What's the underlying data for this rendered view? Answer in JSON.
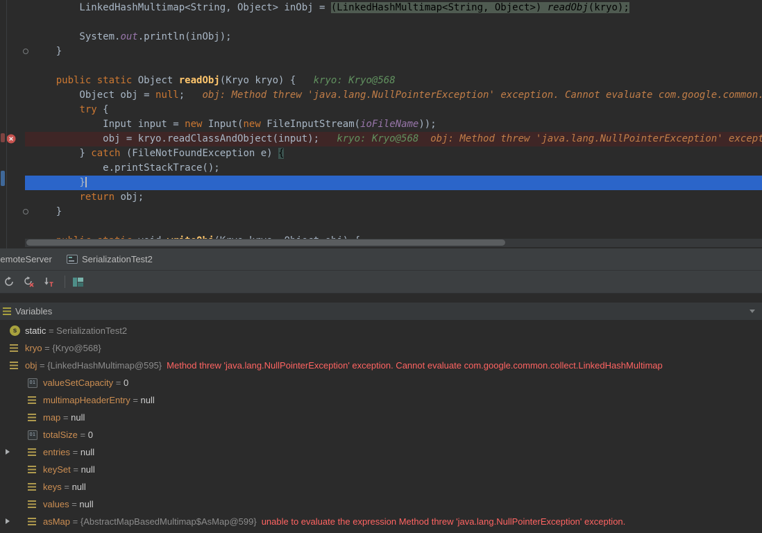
{
  "colors": {
    "editor_bg": "#2B2B2B",
    "panel_bg": "#3C3F41",
    "keyword": "#CC7832",
    "method_decl": "#FFC66D",
    "static_field": "#9876AA",
    "inline_hint_green": "#61915F",
    "inline_hint_error": "#C27E48",
    "execution_line_blue": "#2B65C9",
    "breakpoint_line_red": "#3F2626",
    "breakpoint_icon_red": "#C7534F",
    "error_text_red": "#FF6462",
    "variable_name_amber": "#CC8E52"
  },
  "editor": {
    "lines": [
      {
        "segs": [
          {
            "t": "        LinkedHashMultimap<String, Object> inObj = "
          },
          {
            "t": "(LinkedHashMultimap<String, Object>) ",
            "c": "sel"
          },
          {
            "t": "readObj",
            "c": "sel si"
          },
          {
            "t": "(kryo);",
            "c": "sel"
          }
        ]
      },
      {
        "segs": []
      },
      {
        "segs": [
          {
            "t": "        System."
          },
          {
            "t": "out",
            "c": "f"
          },
          {
            "t": ".println(inObj);"
          }
        ]
      },
      {
        "segs": [
          {
            "t": "    }"
          }
        ],
        "gutter": "fold"
      },
      {
        "segs": []
      },
      {
        "segs": [
          {
            "t": "    "
          },
          {
            "t": "public static ",
            "c": "k"
          },
          {
            "t": "Object "
          },
          {
            "t": "readObj",
            "c": "m"
          },
          {
            "t": "(Kryo kryo) {"
          },
          {
            "t": "   "
          },
          {
            "t": "kryo: Kryo@568",
            "c": "h1"
          }
        ]
      },
      {
        "segs": [
          {
            "t": "        Object obj = "
          },
          {
            "t": "null",
            "c": "k"
          },
          {
            "t": ";"
          },
          {
            "t": "   "
          },
          {
            "t": "obj: Method threw 'java.lang.NullPointerException' exception. Cannot evaluate com.google.common.collect.LinkedHashMultimap",
            "c": "h2"
          }
        ]
      },
      {
        "segs": [
          {
            "t": "        "
          },
          {
            "t": "try",
            "c": "k"
          },
          {
            "t": " {"
          }
        ]
      },
      {
        "segs": [
          {
            "t": "            Input input = "
          },
          {
            "t": "new",
            "c": "k"
          },
          {
            "t": " Input("
          },
          {
            "t": "new",
            "c": "k"
          },
          {
            "t": " FileInputStream("
          },
          {
            "t": "ioFileName",
            "c": "f"
          },
          {
            "t": "));"
          }
        ]
      },
      {
        "segs": [
          {
            "t": "            obj = kryo.readClassAndObject(input);"
          },
          {
            "t": "   "
          },
          {
            "t": "kryo: Kryo@568",
            "c": "h1"
          },
          {
            "t": "  "
          },
          {
            "t": "obj: Method threw 'java.lang.NullPointerException' exception",
            "c": "h2"
          }
        ],
        "bg": "bp",
        "gutter": "breakpoint"
      },
      {
        "segs": [
          {
            "t": "        } "
          },
          {
            "t": "catch",
            "c": "k"
          },
          {
            "t": " (FileNotFoundException e) "
          },
          {
            "t": "{",
            "c": "brace"
          }
        ]
      },
      {
        "segs": [
          {
            "t": "            e.printStackTrace();"
          }
        ]
      },
      {
        "segs": [
          {
            "t": "        }"
          }
        ],
        "bg": "exec",
        "cursor": true
      },
      {
        "segs": [
          {
            "t": "        "
          },
          {
            "t": "return",
            "c": "k"
          },
          {
            "t": " obj;"
          }
        ]
      },
      {
        "segs": [
          {
            "t": "    }"
          }
        ],
        "gutter": "fold"
      },
      {
        "segs": []
      },
      {
        "segs": [
          {
            "t": "    "
          },
          {
            "t": "public static ",
            "c": "k"
          },
          {
            "t": "void "
          },
          {
            "t": "writeObj",
            "c": "m"
          },
          {
            "t": "(Kryo kryo, Object obj) {"
          }
        ]
      }
    ]
  },
  "debugger": {
    "tabs": [
      {
        "label": "RemoteServer"
      },
      {
        "label": "SerializationTest2",
        "icon": "console-icon"
      }
    ],
    "toolbar_icons": [
      "rerun-icon",
      "rerun-failed-icon",
      "type-filter-icon",
      "restore-layout-icon"
    ],
    "variables": {
      "title": "Variables",
      "eq": " = ",
      "rows": [
        {
          "indent": 0,
          "icon": "static",
          "name": "static",
          "nc": "plain",
          "value": "SerializationTest2",
          "vc": "ref"
        },
        {
          "indent": 0,
          "icon": "field",
          "name": "kryo",
          "value": "{Kryo@568}",
          "vc": "ref"
        },
        {
          "indent": 0,
          "icon": "field",
          "name": "obj",
          "value": "{LinkedHashMultimap@595}",
          "vc": "ref",
          "error": "Method threw 'java.lang.NullPointerException' exception. Cannot evaluate com.google.common.collect.LinkedHashMultimap"
        },
        {
          "indent": 1,
          "icon": "primitive",
          "name": "valueSetCapacity",
          "value": "0",
          "vc": "plain"
        },
        {
          "indent": 1,
          "icon": "field",
          "name": "multimapHeaderEntry",
          "value": "null",
          "vc": "plain"
        },
        {
          "indent": 1,
          "icon": "field",
          "name": "map",
          "value": "null",
          "vc": "plain"
        },
        {
          "indent": 1,
          "icon": "primitive",
          "name": "totalSize",
          "value": "0",
          "vc": "plain"
        },
        {
          "indent": 1,
          "icon": "field",
          "name": "entries",
          "value": "null",
          "vc": "plain",
          "expand": true
        },
        {
          "indent": 1,
          "icon": "field",
          "name": "keySet",
          "value": "null",
          "vc": "plain"
        },
        {
          "indent": 1,
          "icon": "field",
          "name": "keys",
          "value": "null",
          "vc": "plain"
        },
        {
          "indent": 1,
          "icon": "field",
          "name": "values",
          "value": "null",
          "vc": "plain"
        },
        {
          "indent": 1,
          "icon": "field",
          "name": "asMap",
          "value": "{AbstractMapBasedMultimap$AsMap@599}",
          "vc": "ref",
          "error": "unable to evaluate the expression Method threw 'java.lang.NullPointerException' exception.",
          "expand": true
        }
      ]
    }
  }
}
